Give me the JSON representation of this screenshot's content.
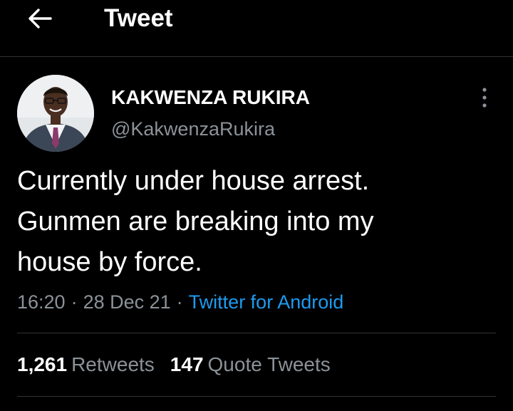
{
  "header": {
    "back_icon": "arrow-left-icon",
    "title": "Tweet"
  },
  "author": {
    "display_name": "KAKWENZA RUKIRA",
    "handle": "@KakwenzaRukira",
    "avatar": "profile-photo"
  },
  "more_icon": "vertical-ellipsis-icon",
  "tweet": {
    "lines": [
      "Currently under house arrest.",
      "Gunmen are breaking into my",
      "house by force."
    ],
    "time": "16:20",
    "date": "28 Dec 21",
    "separator": "·",
    "source": "Twitter for Android"
  },
  "stats": {
    "retweets_count": "1,261",
    "retweets_label": "Retweets",
    "quotes_count": "147",
    "quotes_label": "Quote Tweets"
  },
  "colors": {
    "background": "#000000",
    "text": "#ffffff",
    "secondary": "#8b9298",
    "link": "#1d9bf0",
    "divider": "#2f3336"
  }
}
